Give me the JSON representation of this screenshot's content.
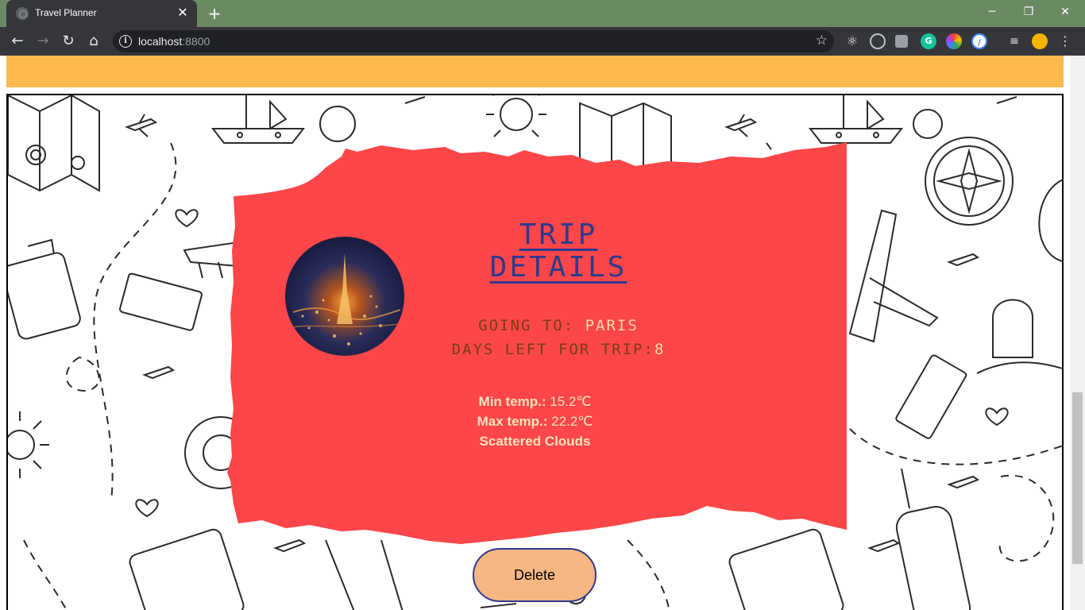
{
  "browser": {
    "tab_title": "Travel Planner",
    "url_host": "localhost",
    "url_port": ":8800"
  },
  "trip": {
    "heading": "TRIP DETAILS",
    "going_to_label": "GOING TO:",
    "destination": "PARIS",
    "days_left_label": "DAYS LEFT FOR TRIP:",
    "days_left": "8",
    "weather": {
      "min_label": "Min temp.:",
      "min_value": "15.2℃",
      "max_label": "Max temp.:",
      "max_value": "22.2℃",
      "description": "Scattered Clouds"
    }
  },
  "actions": {
    "delete_label": "Delete"
  },
  "colors": {
    "chrome_tabbar": "#6b8a64",
    "header_band": "#fdb94e",
    "card": "#fd4649",
    "heading": "#2e3a8c",
    "delete_button": "#f8b682"
  }
}
